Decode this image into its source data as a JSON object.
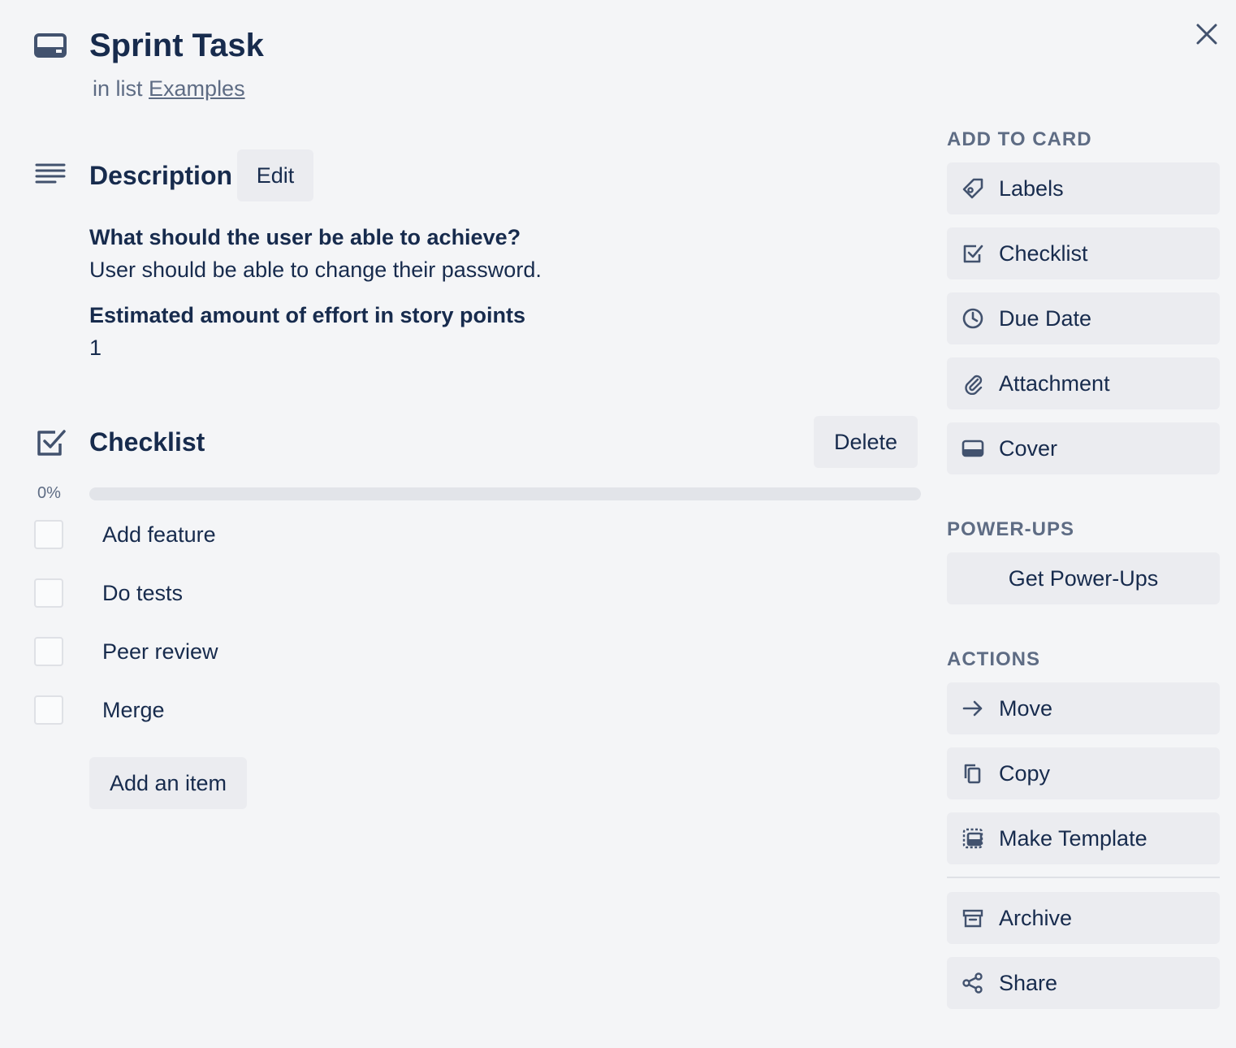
{
  "card": {
    "title": "Sprint Task",
    "in_list_prefix": "in list",
    "list_name": "Examples"
  },
  "description": {
    "heading": "Description",
    "edit_label": "Edit",
    "question1": "What should the user be able to achieve?",
    "answer1": "User should be able to change their password.",
    "question2": "Estimated amount of effort in story points",
    "answer2": "1"
  },
  "checklist": {
    "heading": "Checklist",
    "delete_label": "Delete",
    "progress_label": "0%",
    "progress": 0,
    "items": [
      {
        "label": "Add feature",
        "checked": false
      },
      {
        "label": "Do tests",
        "checked": false
      },
      {
        "label": "Peer review",
        "checked": false
      },
      {
        "label": "Merge",
        "checked": false
      }
    ],
    "add_item_label": "Add an item"
  },
  "sidebar": {
    "add_to_card_heading": "ADD TO CARD",
    "add_to_card": [
      {
        "label": "Labels",
        "icon": "tag-icon"
      },
      {
        "label": "Checklist",
        "icon": "checklist-icon"
      },
      {
        "label": "Due Date",
        "icon": "clock-icon"
      },
      {
        "label": "Attachment",
        "icon": "paperclip-icon"
      },
      {
        "label": "Cover",
        "icon": "cover-icon"
      }
    ],
    "power_ups_heading": "POWER-UPS",
    "get_power_ups_label": "Get Power-Ups",
    "actions_heading": "ACTIONS",
    "actions": [
      {
        "label": "Move",
        "icon": "arrow-right-icon"
      },
      {
        "label": "Copy",
        "icon": "copy-icon"
      },
      {
        "label": "Make Template",
        "icon": "template-icon"
      },
      {
        "label": "Archive",
        "icon": "archive-icon"
      },
      {
        "label": "Share",
        "icon": "share-icon"
      }
    ]
  }
}
